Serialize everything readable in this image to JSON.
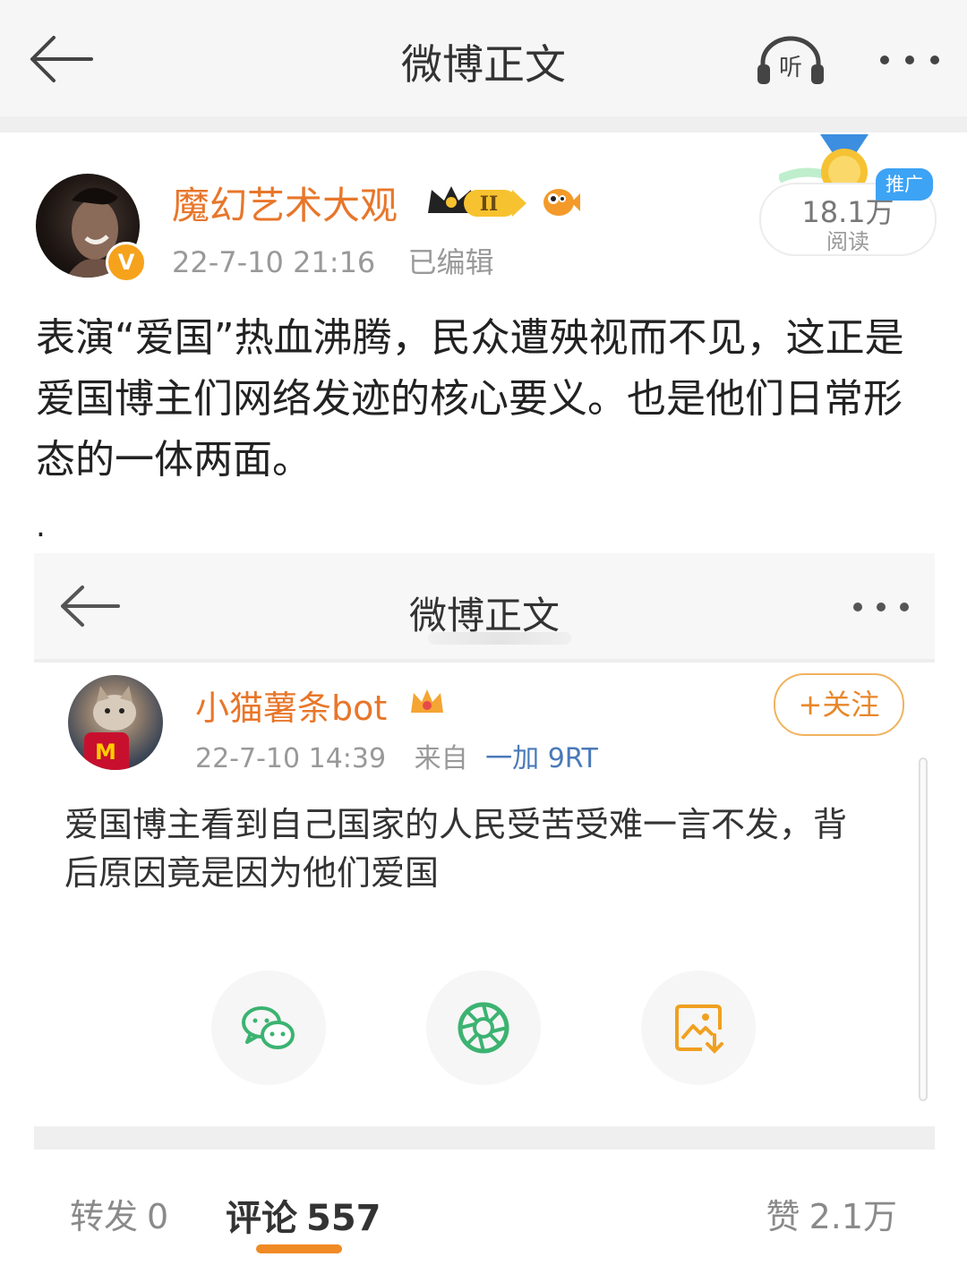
{
  "header": {
    "title": "微博正文"
  },
  "post": {
    "author": "魔幻艺术大观",
    "time": "22-7-10 21:16",
    "edited": "已编辑",
    "verify_badge": "V",
    "promo": {
      "reads": "18.1万",
      "reads_label": "阅读",
      "tag": "推广"
    },
    "text": "表演“爱国”热血沸腾，民众遭殃视而不见，这正是爱国博主们网络发迹的核心要义。也是他们日常形态的一体两面。",
    "trailing": "."
  },
  "screenshot": {
    "header_title": "微博正文",
    "author": "小猫薯条bot",
    "time": "22-7-10 14:39",
    "from_label": "来自",
    "device": "一加 9RT",
    "follow_label": "+关注",
    "text": "爱国博主看到自己国家的人民受苦受难一言不发，背后原因竟是因为他们爱国",
    "cup_letter": "M",
    "share_icons": [
      "wechat-icon",
      "moments-icon",
      "save-image-icon"
    ]
  },
  "tabs": {
    "repost_label": "转发",
    "repost_count": "0",
    "comment_label": "评论",
    "comment_count": "557",
    "like_label": "赞",
    "like_count": "2.1万"
  },
  "colors": {
    "username": "#e8762a",
    "tab_underline": "#f08a24",
    "promo_tag": "#3da3f5",
    "device_link": "#4a7ab8"
  }
}
